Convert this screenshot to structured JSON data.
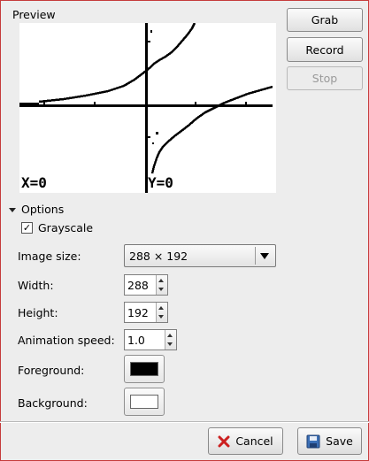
{
  "preview": {
    "title": "Preview",
    "x_readout": "X=0",
    "y_readout": "Y=0"
  },
  "side_buttons": {
    "grab": "Grab",
    "record": "Record",
    "stop": "Stop"
  },
  "options": {
    "header": "Options",
    "grayscale": {
      "label": "Grayscale",
      "checked": true
    },
    "image_size": {
      "label": "Image size:",
      "value": "288 × 192"
    },
    "width": {
      "label": "Width:",
      "value": "288"
    },
    "height": {
      "label": "Height:",
      "value": "192"
    },
    "animation_speed": {
      "label": "Animation speed:",
      "value": "1.0"
    },
    "foreground": {
      "label": "Foreground:",
      "color": "#000000"
    },
    "background": {
      "label": "Background:",
      "color": "#ffffff"
    }
  },
  "dialog_buttons": {
    "cancel": "Cancel",
    "save": "Save"
  }
}
